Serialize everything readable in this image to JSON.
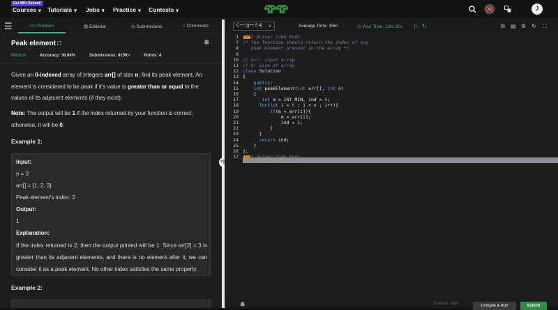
{
  "nav": {
    "promo": "Get 90% Refund!",
    "items": [
      "Courses",
      "Tutorials",
      "Jobs",
      "Practice",
      "Contests"
    ],
    "logo": "GfG",
    "avatar": "J"
  },
  "tabs": [
    "Problem",
    "Editorial",
    "Submissions",
    "Comments"
  ],
  "problem": {
    "title": "Peak element",
    "difficulty": "Medium",
    "accuracy_label": "Accuracy:",
    "accuracy": "38.86%",
    "submissions_label": "Submissions:",
    "submissions": "415K+",
    "points_label": "Points:",
    "points": "4",
    "desc1_a": "Given an ",
    "desc1_b": "0-indexed",
    "desc1_c": " array of integers ",
    "desc1_d": "arr[]",
    "desc1_e": " of size ",
    "desc1_f": "n",
    "desc1_g": ", find its peak element. An element is considered to be peak if it's value is ",
    "desc1_h": "greater than or equal",
    "desc1_i": " to the values of its adjacent elements (if they exist).",
    "note_label": "Note:",
    "note_a": " The output will be ",
    "note_b": "1",
    "note_c": " if the index returned by your function is correct; otherwise, it will be ",
    "note_d": "0",
    "note_e": ".",
    "example1_head": "Example 1:",
    "input_label": "Input:",
    "input_n": "n = 3",
    "input_arr": "arr[] = {1, 2, 3}",
    "input_peak": "Peak element's index: 2",
    "output_label": "Output:",
    "output_val": "1",
    "explanation_label": "Explanation:",
    "explanation": "If the index returned is 2, then the output printed will be 1. Since arr[2] = 3 is greater than its adjacent elements, and there is no element after it, we can consider it as a peak element. No other index satisfies the same property.",
    "example2_head": "Example 2:"
  },
  "editor": {
    "language": "C++ (g++ 5.4)",
    "avg_time": "Average Time: 30m",
    "your_time": "Your Time: 10m 30s",
    "lines": [
      {
        "n": "1",
        "t": "// } Driver Code Ends"
      },
      {
        "n": "7",
        "t": "/* The function should return the index of any"
      },
      {
        "n": "8",
        "t": "   peak element present in the array */"
      },
      {
        "n": "9",
        "t": ""
      },
      {
        "n": "10",
        "t": "// arr: input array"
      },
      {
        "n": "11",
        "t": "// n: size of array"
      },
      {
        "n": "12",
        "t": "class Solution"
      },
      {
        "n": "13",
        "t": "{"
      },
      {
        "n": "14",
        "t": "    public:"
      },
      {
        "n": "15",
        "t": "    int peakElement(int arr[], int n)"
      },
      {
        "n": "16",
        "t": "    {"
      },
      {
        "n": "17",
        "t": "       int m = INT_MIN, ind = 0;"
      },
      {
        "n": "18",
        "t": "      for(int i = 0 ; i < n ; i++){"
      },
      {
        "n": "19",
        "t": "          if(m < arr[i]){"
      },
      {
        "n": "20",
        "t": "              m = arr[i];"
      },
      {
        "n": "21",
        "t": "              ind = i;"
      },
      {
        "n": "22",
        "t": "          }"
      },
      {
        "n": "23",
        "t": "      }"
      },
      {
        "n": "24",
        "t": "      return ind;"
      },
      {
        "n": "25",
        "t": "    }"
      },
      {
        "n": "26",
        "t": "};"
      },
      {
        "n": "27",
        "t": "// } Driver Code Ends"
      }
    ]
  },
  "bottom": {
    "custom_input": "Custom Input",
    "compile": "Compile & Run",
    "submit": "Submit"
  }
}
